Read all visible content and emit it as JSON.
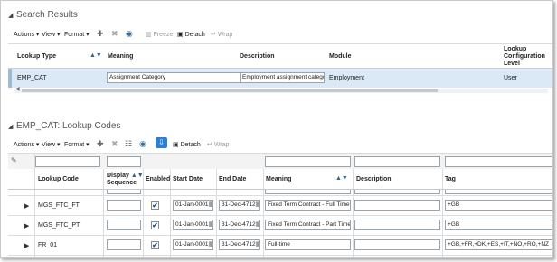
{
  "search": {
    "title": "Search Results",
    "toolbar": {
      "actions": "Actions",
      "view": "View",
      "format": "Format",
      "freeze": "Freeze",
      "detach": "Detach",
      "wrap": "Wrap"
    },
    "columns": {
      "lookup_type": "Lookup Type",
      "meaning": "Meaning",
      "description": "Description",
      "module": "Module",
      "config_level_1": "Lookup",
      "config_level_2": "Configuration",
      "config_level_3": "Level"
    },
    "row": {
      "lookup_type": "EMP_CAT",
      "meaning": "Assignment Category",
      "description": "Employment assignment categories",
      "module": "Employment",
      "config_level": "User"
    }
  },
  "codes": {
    "title": "EMP_CAT: Lookup Codes",
    "toolbar": {
      "actions": "Actions",
      "view": "View",
      "format": "Format",
      "detach": "Detach",
      "wrap": "Wrap"
    },
    "columns": {
      "lookup_code": "Lookup Code",
      "display_seq_1": "Display",
      "display_seq_2": "Sequence",
      "enabled": "Enabled",
      "start_date": "Start Date",
      "end_date": "End Date",
      "meaning": "Meaning",
      "description": "Description",
      "tag": "Tag"
    },
    "rows": [
      {
        "code": "MGS_FTC_FT",
        "start": "01-Jan-0001",
        "end": "31-Dec-4712",
        "meaning": "Fixed Term Contract - Full Time",
        "tag": "+GB"
      },
      {
        "code": "MGS_FTC_PT",
        "start": "01-Jan-0001",
        "end": "31-Dec-4712",
        "meaning": "Fixed Term Contract - Part Time",
        "tag": "+GB"
      },
      {
        "code": "FR_01",
        "start": "01-Jan-0001",
        "end": "31-Dec-4712",
        "meaning": "Full-time",
        "tag": "+GB,+FR,+DK,+ES,+IT,+NO,+RO,+NZ"
      }
    ],
    "checkmark": "✔"
  }
}
